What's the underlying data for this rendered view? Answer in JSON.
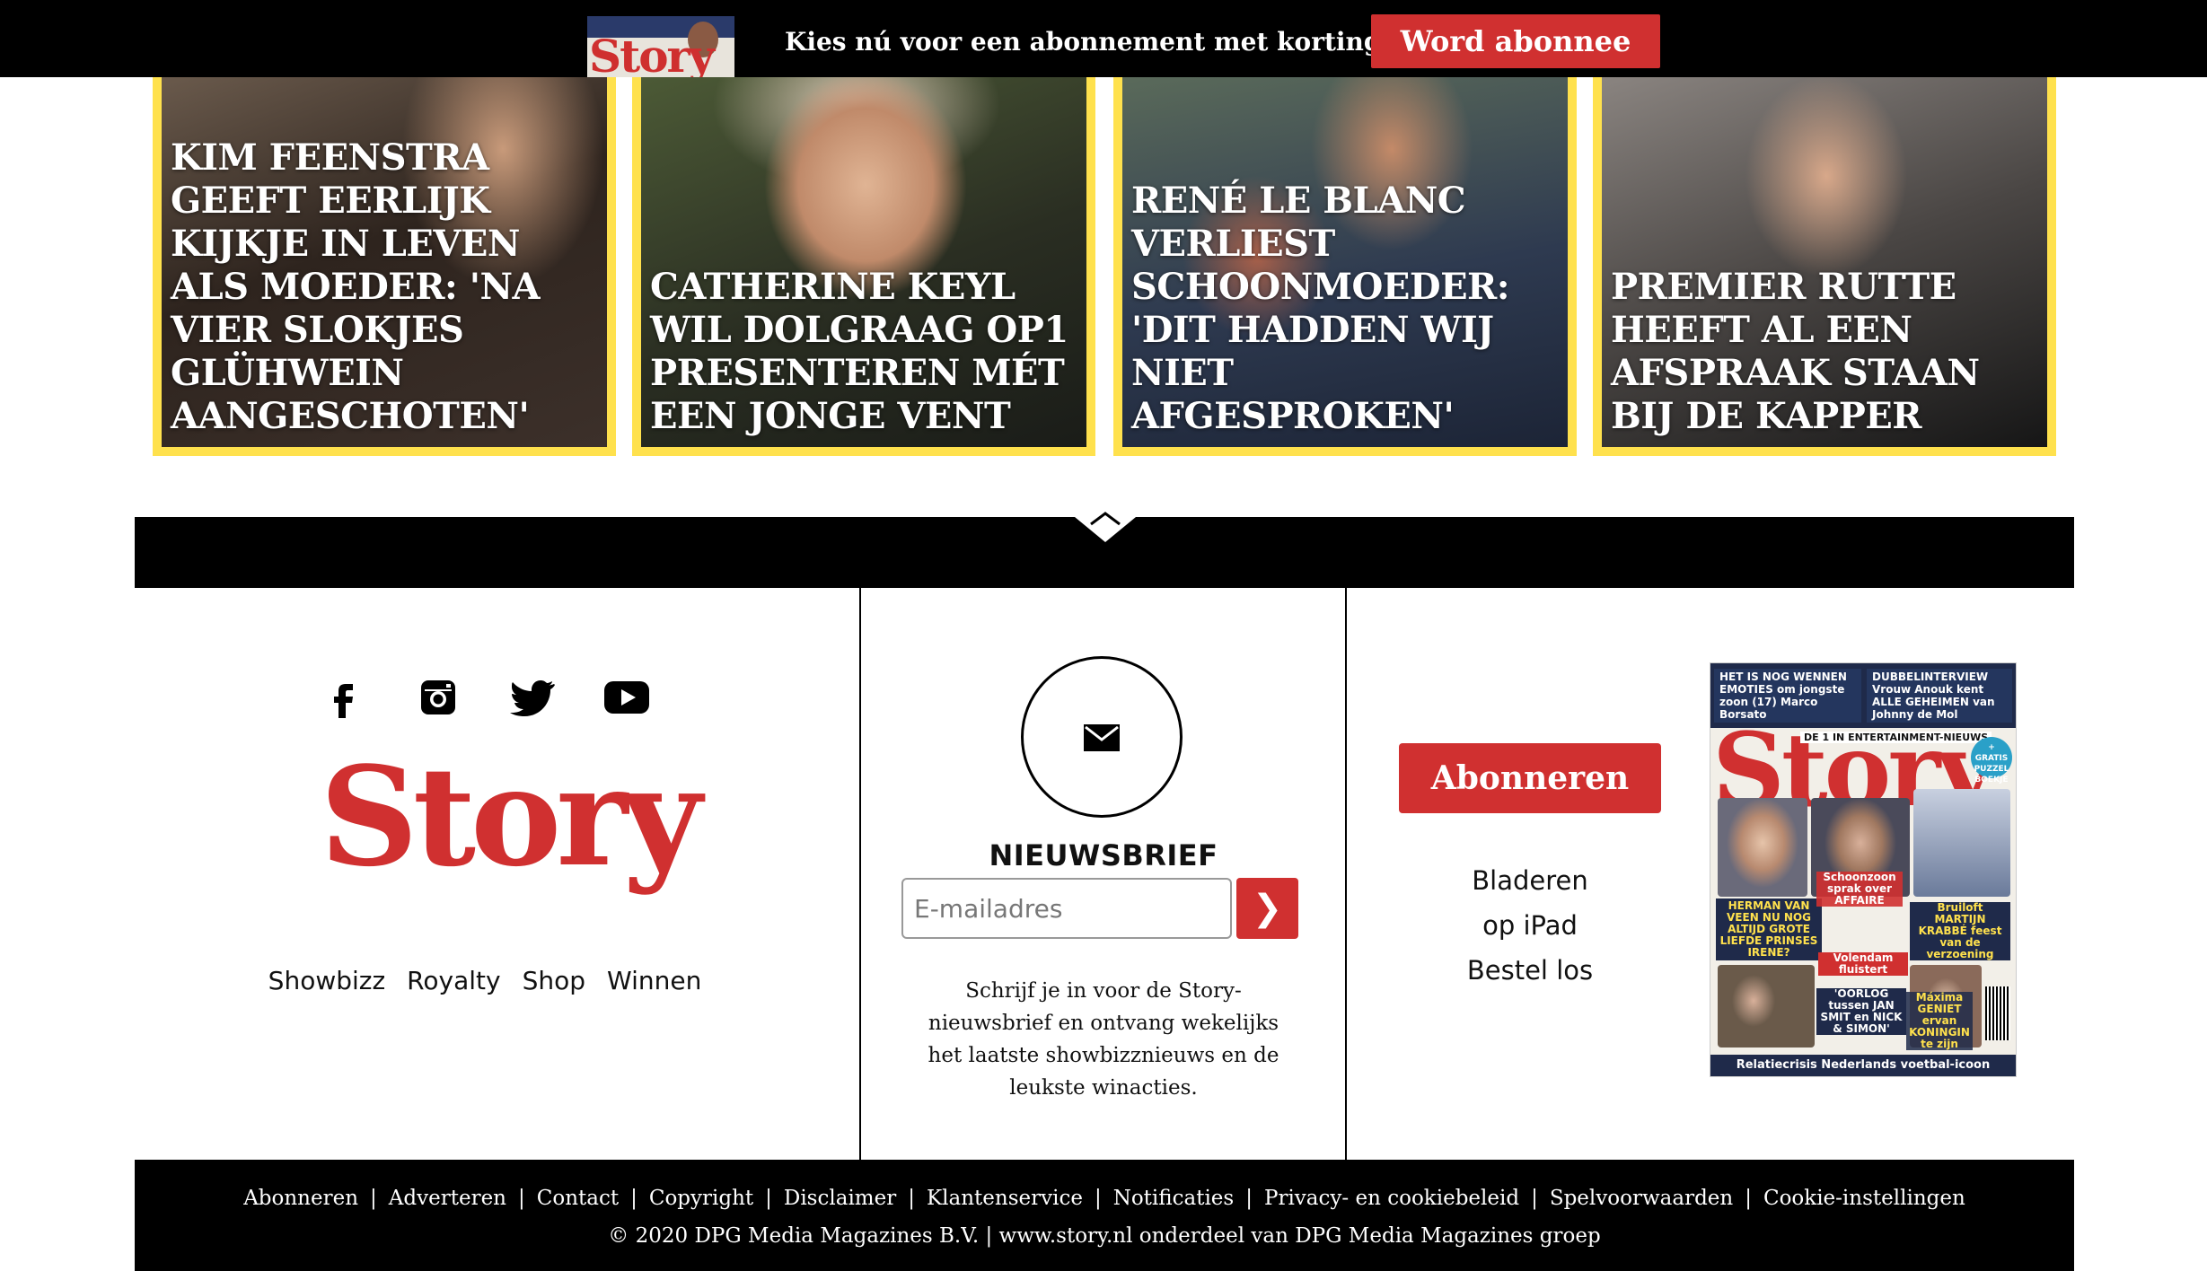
{
  "promo_bar": {
    "text": "Kies nú voor een abonnement met korting",
    "button_label": "Word abonnee",
    "cover_word": "Story"
  },
  "cards": [
    {
      "title": "Kim Feenstra geeft eerlijk kijkje in leven als moeder: 'Na vier slokjes glühwein aangeschoten'"
    },
    {
      "title": "Catherine Keyl wil dolgraag Op1 presenteren mét een jonge vent"
    },
    {
      "title": "René le Blanc verliest schoonmoeder: 'Dit hadden wij niet afgesproken'"
    },
    {
      "title": "Premier Rutte heeft al een afspraak staan bij de kapper"
    }
  ],
  "social_icons": [
    "facebook-icon",
    "instagram-icon",
    "twitter-icon",
    "youtube-icon"
  ],
  "logo_text": "Story",
  "nav_links": [
    "Showbizz",
    "Royalty",
    "Shop",
    "Winnen"
  ],
  "newsletter": {
    "title": "NIEUWSBRIEF",
    "placeholder": "E-mailadres",
    "submit_symbol": "❯",
    "description": "Schrijf je in voor de Story-nieuwsbrief en ontvang wekelijks het laatste showbizznieuws en de leukste winacties."
  },
  "subscribe": {
    "button_label": "Abonneren",
    "links": [
      "Bladeren",
      "op iPad",
      "Bestel los"
    ]
  },
  "magazine_cover": {
    "brand": "Story",
    "header_left": "HET IS NOG WENNEN\nEMOTIES om jongste zoon (17) Marco Borsato",
    "header_right": "DUBBELINTERVIEW\nVrouw Anouk kent ALLE GEHEIMEN van Johnny de Mol",
    "tagline": "DE 1 IN ENTERTAINMENT-NIEUWS",
    "badge": "+ GRATIS PUZZEL BOEKJE",
    "headline_main": "HERMAN VAN VEEN NU NOG ALTIJD GROTE LIEFDE PRINSES IRENE?",
    "headline_mid": "Schoonzoon sprak over AFFAIRE",
    "headline_wedding": "Bruiloft MARTIJN KRABBÉ feest van de verzoening",
    "headline_volendam": "Volendam fluistert",
    "headline_oorlog": "'OORLOG tussen JAN SMIT en NICK & SIMON'",
    "headline_maxima": "Máxima GENIET ervan KONINGIN te zijn",
    "footer_line": "Relatiecrisis Nederlands voetbal-icoon"
  },
  "footer": {
    "links": [
      "Abonneren",
      "Adverteren",
      "Contact",
      "Copyright",
      "Disclaimer",
      "Klantenservice",
      "Notificaties",
      "Privacy- en cookiebeleid",
      "Spelvoorwaarden",
      "Cookie-instellingen"
    ],
    "copyright": "© 2020 DPG Media Magazines B.V. | www.story.nl onderdeel van DPG Media Magazines groep"
  }
}
